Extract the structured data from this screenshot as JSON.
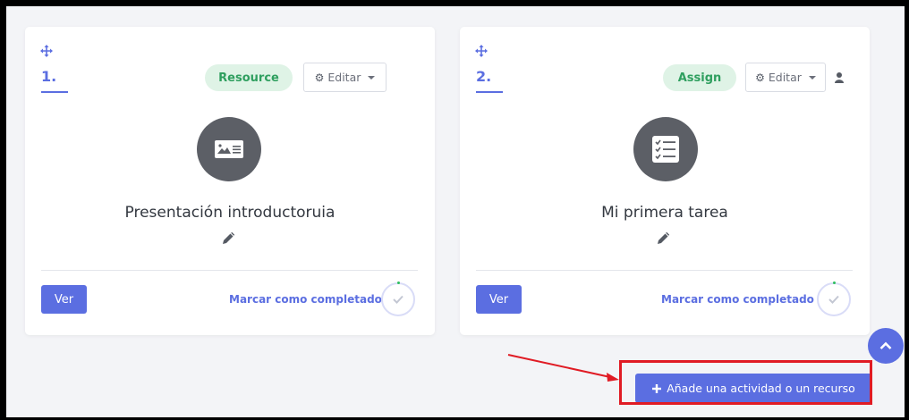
{
  "cards": [
    {
      "number": "1.",
      "type_badge": "Resource",
      "edit_label": "Editar",
      "icon": "image-card-icon",
      "title": "Presentación introductoruia",
      "view_label": "Ver",
      "complete_label": "Marcar como completado"
    },
    {
      "number": "2.",
      "type_badge": "Assign",
      "edit_label": "Editar",
      "icon": "checklist-icon",
      "title": "Mi primera tarea",
      "view_label": "Ver",
      "complete_label": "Marcar como completado"
    }
  ],
  "actions": {
    "add_activity_label": "Añade una actividad o un recurso",
    "add_icon": "plus-icon",
    "scroll_top_icon": "chevron-up-icon"
  },
  "colors": {
    "accent": "#5b6ee1",
    "badge_bg": "#dff3e6",
    "badge_text": "#2f9f5f",
    "annotation": "#e01b24",
    "icon_circle": "#5c5f66"
  }
}
